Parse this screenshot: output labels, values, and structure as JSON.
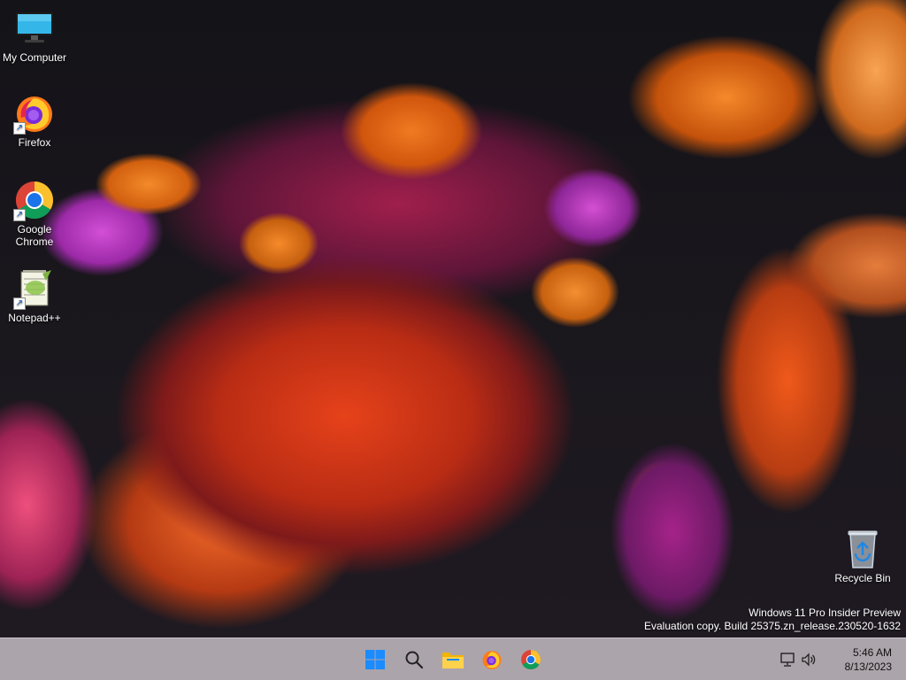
{
  "desktop": {
    "icons": [
      {
        "label": "My Computer",
        "icon": "monitor-icon"
      },
      {
        "label": "Firefox",
        "icon": "firefox-icon",
        "shortcut": true
      },
      {
        "label": "Google Chrome",
        "icon": "chrome-icon",
        "shortcut": true
      },
      {
        "label": "Notepad++",
        "icon": "notepad-plus-plus-icon",
        "shortcut": true
      },
      {
        "label": "Recycle Bin",
        "icon": "recycle-bin-icon"
      }
    ]
  },
  "watermark": {
    "line1": "Windows 11 Pro Insider Preview",
    "line2": "Evaluation copy. Build 25375.zn_release.230520-1632"
  },
  "taskbar": {
    "apps": [
      {
        "name": "start",
        "icon": "windows-start-icon"
      },
      {
        "name": "search",
        "icon": "search-icon"
      },
      {
        "name": "file-explorer",
        "icon": "folder-icon"
      },
      {
        "name": "firefox",
        "icon": "firefox-icon"
      },
      {
        "name": "chrome",
        "icon": "chrome-icon"
      }
    ],
    "tray": {
      "network_icon": "network-icon",
      "volume_icon": "speaker-icon",
      "time": "5:46 AM",
      "date": "8/13/2023"
    }
  },
  "colors": {
    "taskbar_bg": "#e2dae0",
    "accent": "#0078d4"
  }
}
